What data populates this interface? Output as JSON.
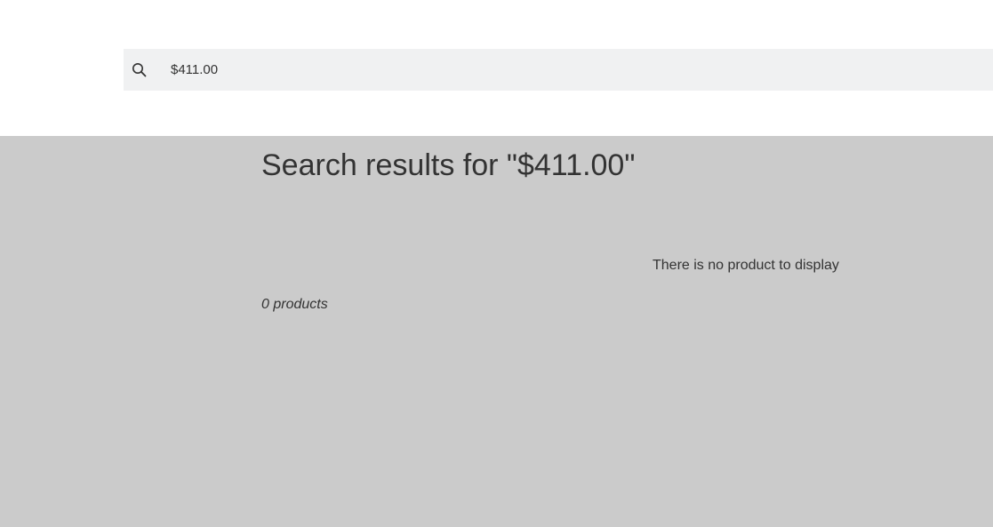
{
  "header": {
    "search": {
      "value": "$411.00",
      "icon": "search-icon"
    }
  },
  "main": {
    "title": "Search results for \"$411.00\"",
    "empty_message": "There is no product to display",
    "product_count": "0 products"
  },
  "colors": {
    "header_background": "#ffffff",
    "search_background": "#f0f1f2",
    "content_background": "#cbcbcb",
    "text": "#333333"
  }
}
